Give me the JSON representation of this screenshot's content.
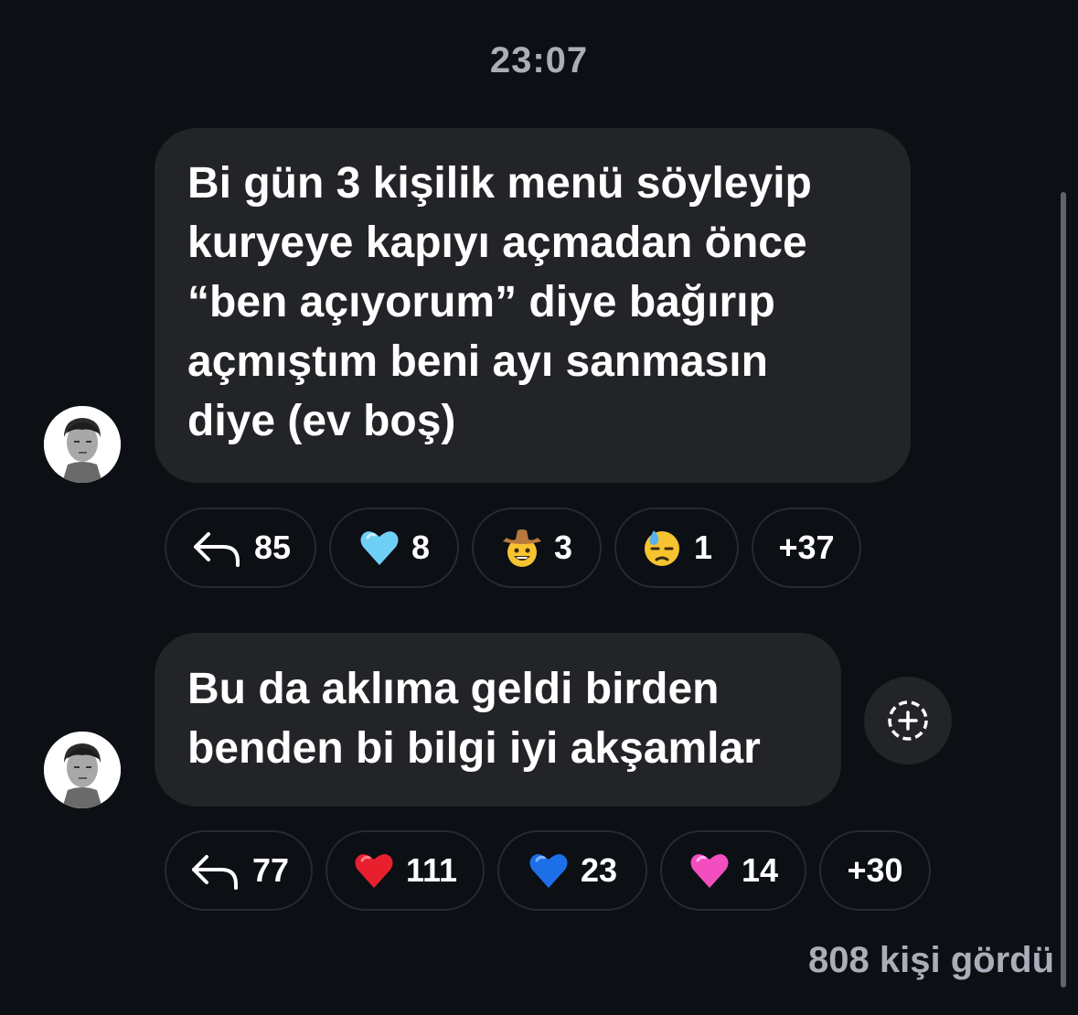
{
  "thread": {
    "timestamp": "23:07",
    "seen_count_label": "808 kişi gördü"
  },
  "messages": [
    {
      "lines": [
        "Bi gün 3 kişilik menü söyleyip",
        "kuryeye kapıyı açmadan önce",
        "“ben açıyorum” diye bağırıp",
        "açmıştım beni ayı sanmasın",
        "diye (ev boş)"
      ],
      "reactions": {
        "reply_count": "85",
        "items": [
          {
            "emoji": "light-blue-heart",
            "count": "8"
          },
          {
            "emoji": "cowboy-hat-face",
            "count": "3"
          },
          {
            "emoji": "downcast-face-with-sweat",
            "count": "1"
          }
        ],
        "more": "+37"
      }
    },
    {
      "lines": [
        "Bu da aklıma geldi birden",
        "benden bi bilgi iyi akşamlar"
      ],
      "reactions": {
        "reply_count": "77",
        "items": [
          {
            "emoji": "red-heart",
            "count": "111"
          },
          {
            "emoji": "blue-heart",
            "count": "23"
          },
          {
            "emoji": "pink-heart",
            "count": "14"
          }
        ],
        "more": "+30"
      }
    }
  ],
  "colors": {
    "background": "#0c0f14",
    "bubble": "#222428",
    "muted_text": "#a9aeb8",
    "red_heart": "#e8202e",
    "blue_heart": "#1d6fe8",
    "light_blue_heart": "#6fd0f5",
    "pink_heart": "#f24ec0"
  }
}
